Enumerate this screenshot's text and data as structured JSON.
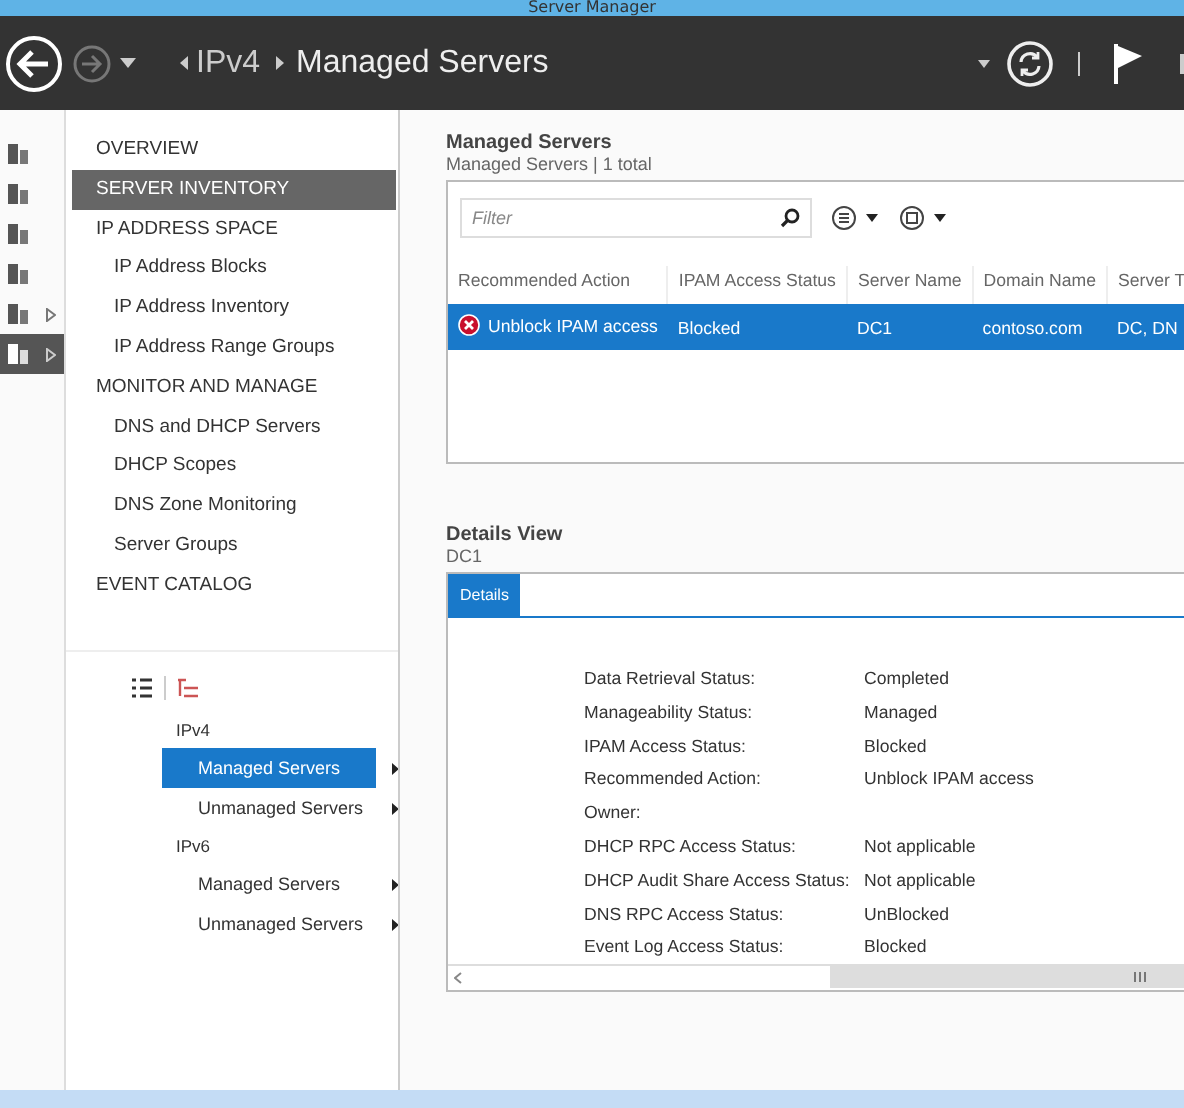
{
  "window": {
    "title": "Server Manager"
  },
  "header": {
    "breadcrumb": [
      "IPv4",
      "Managed Servers"
    ]
  },
  "icon_strip": [
    {
      "selected": false,
      "expandable": false
    },
    {
      "selected": false,
      "expandable": false
    },
    {
      "selected": false,
      "expandable": false
    },
    {
      "selected": false,
      "expandable": false
    },
    {
      "selected": false,
      "expandable": true
    },
    {
      "selected": true,
      "expandable": true
    }
  ],
  "nav": [
    {
      "label": "OVERVIEW",
      "selected": false
    },
    {
      "label": "SERVER INVENTORY",
      "selected": true
    },
    {
      "label": "IP ADDRESS SPACE",
      "selected": false,
      "children": [
        {
          "label": "IP Address Blocks",
          "selected": false
        },
        {
          "label": "IP Address Inventory",
          "selected": false
        },
        {
          "label": "IP Address Range Groups",
          "selected": false
        }
      ]
    },
    {
      "label": "MONITOR AND MANAGE",
      "selected": false,
      "children": [
        {
          "label": "DNS and DHCP Servers",
          "selected": false
        },
        {
          "label": "DHCP Scopes",
          "selected": false
        },
        {
          "label": "DNS Zone Monitoring",
          "selected": false
        },
        {
          "label": "Server Groups",
          "selected": false
        }
      ]
    },
    {
      "label": "EVENT CATALOG",
      "selected": false
    }
  ],
  "tree": [
    {
      "label": "IPv4",
      "children": [
        {
          "label": "Managed Servers",
          "selected": true
        },
        {
          "label": "Unmanaged Servers",
          "selected": false
        }
      ]
    },
    {
      "label": "IPv6",
      "children": [
        {
          "label": "Managed Servers",
          "selected": false
        },
        {
          "label": "Unmanaged Servers",
          "selected": false
        }
      ]
    }
  ],
  "servers": {
    "title": "Managed Servers",
    "subtitle": "Managed Servers | 1 total",
    "filter": {
      "placeholder": "Filter"
    },
    "columns": [
      "Recommended Action",
      "IPAM Access Status",
      "Server Name",
      "Domain Name",
      "Server T"
    ],
    "rows": [
      {
        "selected": true,
        "error": true,
        "cells": [
          "Unblock IPAM access",
          "Blocked",
          "DC1",
          "contoso.com",
          "DC, DN"
        ]
      }
    ]
  },
  "details": {
    "title": "Details View",
    "subtitle": "DC1",
    "tabs": [
      {
        "label": "Details",
        "selected": true
      }
    ],
    "fields": [
      {
        "label": "Data Retrieval Status:",
        "value": "Completed"
      },
      {
        "label": "Manageability Status:",
        "value": "Managed"
      },
      {
        "label": "IPAM Access Status:",
        "value": "Blocked"
      },
      {
        "label": "Recommended Action:",
        "value": "Unblock IPAM access"
      },
      {
        "label": "Owner:"
      },
      {
        "label": "DHCP RPC Access Status:",
        "value": "Not applicable"
      },
      {
        "label": "DHCP Audit Share Access Status:",
        "value": "Not applicable"
      },
      {
        "label": "DNS RPC Access Status:",
        "value": "UnBlocked"
      },
      {
        "label": "Event Log Access Status:",
        "value": "Blocked"
      }
    ]
  }
}
